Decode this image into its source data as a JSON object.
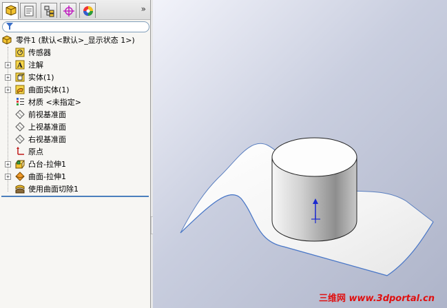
{
  "tabs": [
    {
      "name": "featuremanager-tab",
      "icon": "feature-tree-icon"
    },
    {
      "name": "propertymanager-tab",
      "icon": "property-icon"
    },
    {
      "name": "configurationmanager-tab",
      "icon": "configuration-icon"
    },
    {
      "name": "dimxpert-tab",
      "icon": "crosshair-icon"
    },
    {
      "name": "display-manager-tab",
      "icon": "appearance-icon"
    }
  ],
  "more_tabs": "»",
  "tree": {
    "root": "零件1  (默认<默认>_显示状态 1>)",
    "items": [
      {
        "label": "传感器",
        "icon": "sensors-icon",
        "expandable": false
      },
      {
        "label": "注解",
        "icon": "annotations-icon",
        "expandable": true
      },
      {
        "label": "实体(1)",
        "icon": "solid-bodies-icon",
        "expandable": true
      },
      {
        "label": "曲面实体(1)",
        "icon": "surface-bodies-icon",
        "expandable": true
      },
      {
        "label": "材质 <未指定>",
        "icon": "material-icon",
        "expandable": false
      },
      {
        "label": "前视基准面",
        "icon": "plane-icon",
        "expandable": false
      },
      {
        "label": "上视基准面",
        "icon": "plane-icon",
        "expandable": false
      },
      {
        "label": "右视基准面",
        "icon": "plane-icon",
        "expandable": false
      },
      {
        "label": "原点",
        "icon": "origin-icon",
        "expandable": false
      },
      {
        "label": "凸台-拉伸1",
        "icon": "boss-extrude-icon",
        "expandable": true
      },
      {
        "label": "曲面-拉伸1",
        "icon": "surface-extrude-icon",
        "expandable": true
      },
      {
        "label": "使用曲面切除1",
        "icon": "cut-with-surface-icon",
        "expandable": false
      }
    ]
  },
  "watermark": {
    "cn": "三维网",
    "url": "www.3dportal.cn"
  },
  "colors": {
    "accent": "#4a7ebd",
    "watermark": "#e01010"
  }
}
